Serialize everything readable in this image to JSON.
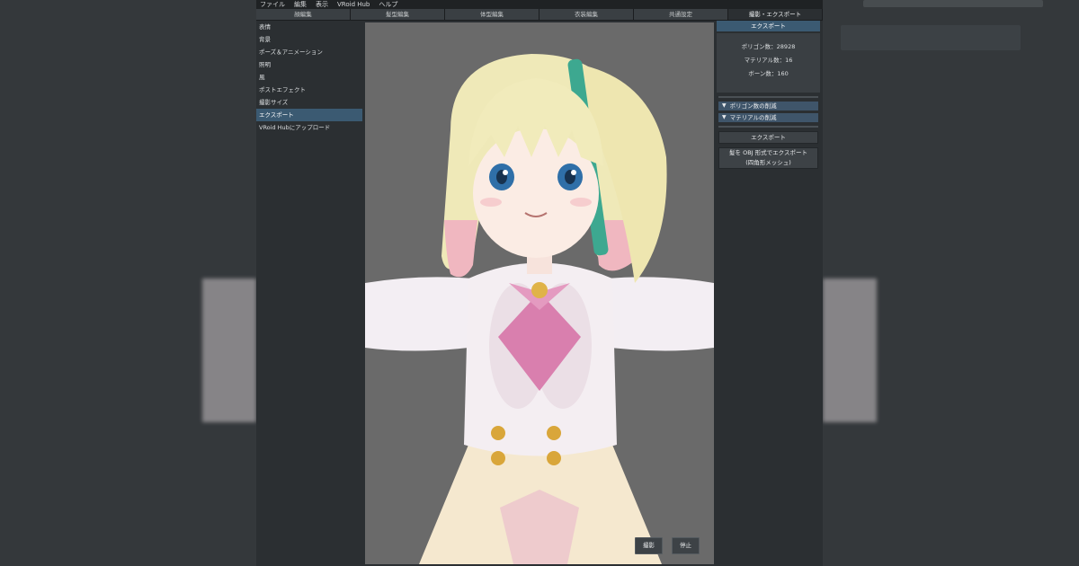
{
  "menu": [
    "ファイル",
    "編集",
    "表示",
    "VRoid Hub",
    "ヘルプ"
  ],
  "tabs": [
    {
      "label": "顔編集",
      "active": false
    },
    {
      "label": "髪型編集",
      "active": false
    },
    {
      "label": "体型編集",
      "active": false
    },
    {
      "label": "衣装編集",
      "active": false
    },
    {
      "label": "共通設定",
      "active": false
    },
    {
      "label": "撮影・エクスポート",
      "active": true
    }
  ],
  "sidebar": {
    "items": [
      {
        "label": "表情",
        "active": false
      },
      {
        "label": "背景",
        "active": false
      },
      {
        "label": "ポーズ＆アニメーション",
        "active": false
      },
      {
        "label": "照明",
        "active": false
      },
      {
        "label": "風",
        "active": false
      },
      {
        "label": "ポストエフェクト",
        "active": false
      },
      {
        "label": "撮影サイズ",
        "active": false
      },
      {
        "label": "エクスポート",
        "active": true
      },
      {
        "label": "VRoid Hubにアップロード",
        "active": false
      }
    ]
  },
  "viewport": {
    "capture_label": "撮影",
    "stop_label": "停止"
  },
  "export_panel": {
    "header": "エクスポート",
    "polygon_count": "ポリゴン数：28928",
    "material_count": "マテリアル数：16",
    "bone_count": "ボーン数：160",
    "reduce_polygons": "ポリゴン数の削減",
    "reduce_materials": "マテリアルの削減",
    "export_button": "エクスポート",
    "export_hair_obj_line1": "髪を OBJ 形式でエクスポート",
    "export_hair_obj_line2": "(四角形メッシュ)"
  },
  "colors": {
    "accent": "#3b5a72",
    "panel": "#2b2f32",
    "viewport_bg": "#6a6a6a"
  }
}
